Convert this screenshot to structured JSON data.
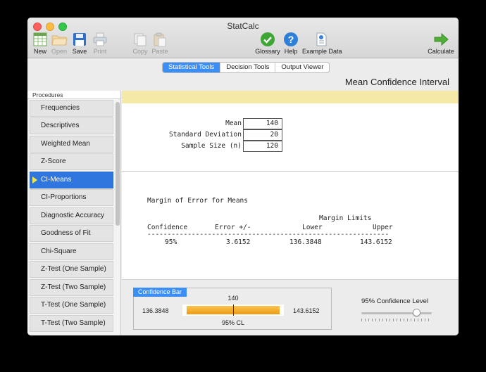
{
  "window": {
    "title": "StatCalc"
  },
  "toolbar": {
    "new_label": "New",
    "open_label": "Open",
    "save_label": "Save",
    "print_label": "Print",
    "copy_label": "Copy",
    "paste_label": "Paste",
    "glossary_label": "Glossary",
    "help_label": "Help",
    "example_label": "Example Data",
    "calculate_label": "Calculate"
  },
  "tabs": [
    {
      "label": "Statistical Tools",
      "active": true
    },
    {
      "label": "Decision Tools",
      "active": false
    },
    {
      "label": "Output Viewer",
      "active": false
    }
  ],
  "page_heading": "Mean Confidence Interval",
  "sidebar": {
    "header": "Procedures",
    "items": [
      {
        "label": "Frequencies",
        "active": false
      },
      {
        "label": "Descriptives",
        "active": false
      },
      {
        "label": "Weighted Mean",
        "active": false
      },
      {
        "label": "Z-Score",
        "active": false
      },
      {
        "label": "CI-Means",
        "active": true
      },
      {
        "label": "CI-Proportions",
        "active": false
      },
      {
        "label": "Diagnostic Accuracy",
        "active": false
      },
      {
        "label": "Goodness of Fit",
        "active": false
      },
      {
        "label": "Chi-Square",
        "active": false
      },
      {
        "label": "Z-Test (One Sample)",
        "active": false
      },
      {
        "label": "Z-Test (Two Sample)",
        "active": false
      },
      {
        "label": "T-Test (One Sample)",
        "active": false
      },
      {
        "label": "T-Test (Two Sample)",
        "active": false
      }
    ]
  },
  "inputs": {
    "mean": {
      "label": "Mean",
      "value": "140"
    },
    "sd": {
      "label": "Standard Deviation",
      "value": "20"
    },
    "n": {
      "label": "Sample Size (n)",
      "value": "120"
    }
  },
  "results": {
    "title": "Margin of Error for Means",
    "group_header": "Margin Limits",
    "columns": [
      "Confidence",
      "Error +/-",
      "Lower",
      "Upper"
    ],
    "rule": "------------------------------------------------------------",
    "row": {
      "confidence": "95%",
      "error": "3.6152",
      "lower": "136.3848",
      "upper": "143.6152"
    }
  },
  "confidence_bar": {
    "title": "Confidence Bar",
    "mean_label": "140",
    "lower_label": "136.3848",
    "upper_label": "143.6152",
    "cl_label": "95% CL",
    "mean": 140,
    "lower": 136.3848,
    "upper": 143.6152
  },
  "confidence_level": {
    "label": "95% Confidence Level",
    "slider_fraction": 0.78
  },
  "colors": {
    "accent": "#3b8ef5",
    "selection": "#2f76de",
    "bar_fill": "#f2a92a",
    "yellow_band": "#f5e9a8"
  }
}
